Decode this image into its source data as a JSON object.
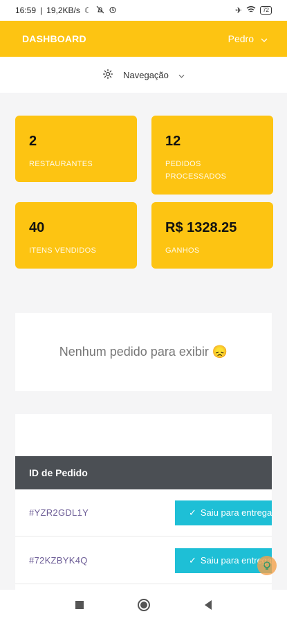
{
  "status": {
    "time": "16:59",
    "speed": "19,2KB/s",
    "battery": "72"
  },
  "header": {
    "brand": "DASHBOARD",
    "user": "Pedro"
  },
  "nav": {
    "label": "Navegação"
  },
  "stats": [
    {
      "value": "2",
      "label": "RESTAURANTES"
    },
    {
      "value": "12",
      "label": "PEDIDOS PROCESSADOS"
    },
    {
      "value": "40",
      "label": "ITENS VENDIDOS"
    },
    {
      "value": "R$ 1328.25",
      "label": "GANHOS"
    }
  ],
  "empty_message": "Nenhum pedido para exibir 😞",
  "table": {
    "header": "ID de Pedido",
    "rows": [
      {
        "id": "#YZR2GDL1Y",
        "status": "Saiu para entrega"
      },
      {
        "id": "#72KZBYK4Q",
        "status": "Saiu para entrega"
      }
    ]
  },
  "colors": {
    "accent": "#fdc412",
    "status": "#1ebfd6",
    "header_dark": "#4b4f54"
  }
}
